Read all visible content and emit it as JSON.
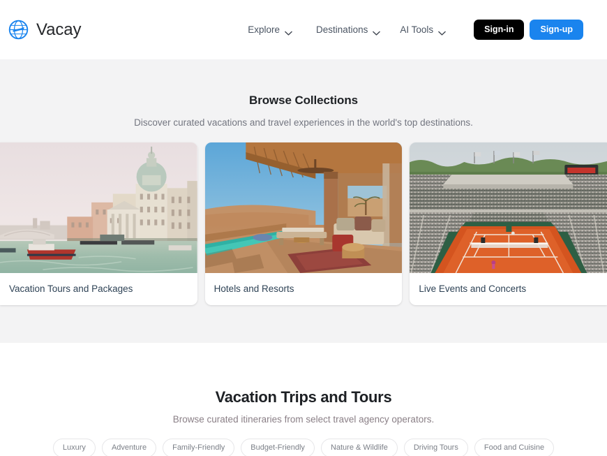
{
  "brand": {
    "name": "Vacay",
    "logo_icon": "globe-airplane-icon",
    "accent_color": "#1a84ee"
  },
  "header": {
    "nav": [
      {
        "label": "Explore",
        "icon": "chevron-down-icon"
      },
      {
        "label": "Destinations",
        "icon": "chevron-down-icon"
      },
      {
        "label": "AI Tools",
        "icon": "chevron-down-icon"
      }
    ],
    "sign_in_label": "Sign-in",
    "sign_up_label": "Sign-up",
    "sign_in_color": "#000000",
    "sign_up_color": "#1a84ee"
  },
  "collections": {
    "title": "Browse Collections",
    "subtitle": "Discover curated vacations and travel experiences in the world's top destinations.",
    "background_color": "#f3f3f4",
    "cards": [
      {
        "label": "Vacation Tours and Packages",
        "image_alt": "venice-grand-canal-photo"
      },
      {
        "label": "Hotels and Resorts",
        "image_alt": "desert-resort-pool-terrace-photo"
      },
      {
        "label": "Live Events and Concerts",
        "image_alt": "clay-tennis-stadium-crowd-photo"
      }
    ]
  },
  "trips": {
    "title": "Vacation Trips and Tours",
    "subtitle": "Browse curated itineraries from select travel agency operators.",
    "pills": [
      {
        "label": "Luxury"
      },
      {
        "label": "Adventure"
      },
      {
        "label": "Family-Friendly"
      },
      {
        "label": "Budget-Friendly"
      },
      {
        "label": "Nature & Wildlife"
      },
      {
        "label": "Driving Tours"
      },
      {
        "label": "Food and Cuisine"
      }
    ]
  }
}
